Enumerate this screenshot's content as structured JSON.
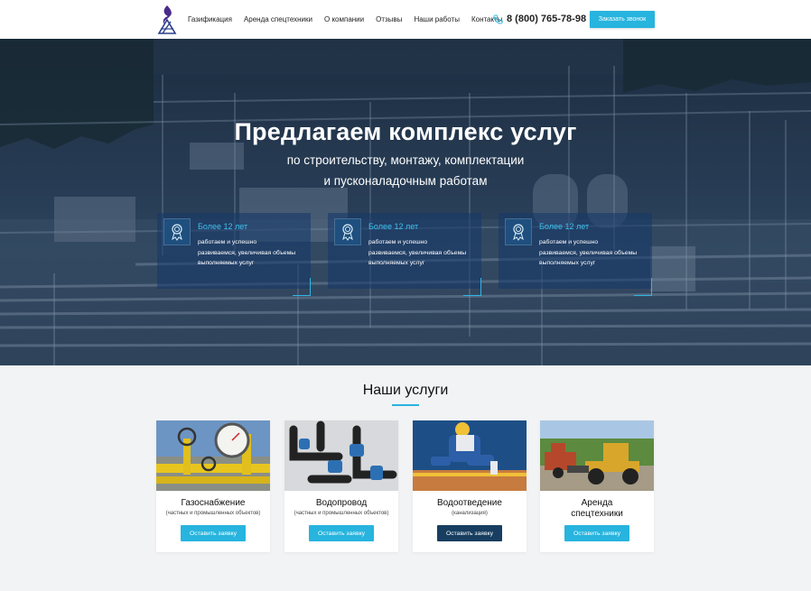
{
  "header": {
    "nav": [
      "Газификация",
      "Аренда спецтехники",
      "О компании",
      "Отзывы",
      "Наши работы",
      "Контакты"
    ],
    "phone": "8 (800) 765-78-98",
    "call_button": "Заказать звонок"
  },
  "hero": {
    "title": "Предлагаем комплекс услуг",
    "subtitle_line1": "по строительству, монтажу, комплектации",
    "subtitle_line2": "и пусконаладочным  работам",
    "features": [
      {
        "title": "Более 12 лет",
        "line1": "работаем и  успешно",
        "line2": "развиваемся, увеличивая объемы",
        "line3": "выполняемых услуг"
      },
      {
        "title": "Более 12 лет",
        "line1": "работаем и  успешно",
        "line2": "развиваемся, увеличивая объемы",
        "line3": "выполняемых услуг"
      },
      {
        "title": "Более 12 лет",
        "line1": "работаем и  успешно",
        "line2": "развиваемся, увеличивая объемы",
        "line3": "выполняемых услуг"
      }
    ]
  },
  "services": {
    "title": "Наши услуги",
    "cards": [
      {
        "name": "Газоснабжение",
        "note": "(частных и промышленных объектов)",
        "button": "Оставить заявку"
      },
      {
        "name": "Водопровод",
        "note": "(частных и промышленных объектов)",
        "button": "Оставить заявку"
      },
      {
        "name": "Водоотведение",
        "note": "(канализация)",
        "button": "Оставить заявку"
      },
      {
        "name": "Аренда спецтехники",
        "note": "",
        "button": "Оставить заявку"
      }
    ]
  },
  "colors": {
    "accent": "#27b4de",
    "dark_button": "#173e61",
    "feature_title": "#3fc2ee"
  }
}
